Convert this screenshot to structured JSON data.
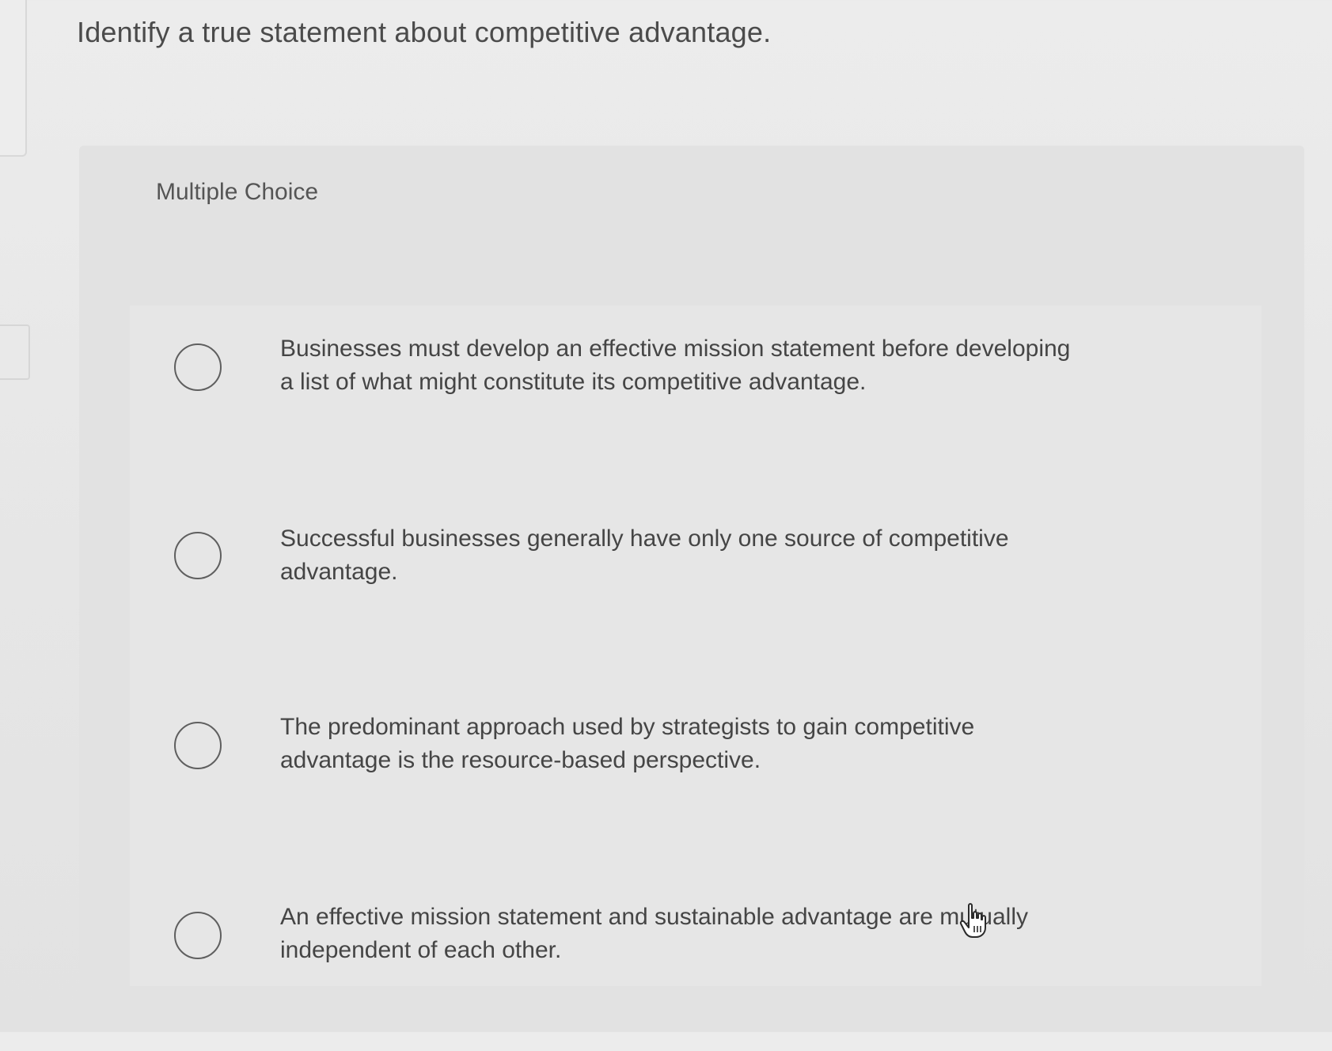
{
  "question": {
    "text": "Identify a true statement about competitive advantage."
  },
  "panel": {
    "label": "Multiple Choice"
  },
  "options": [
    {
      "text": "Businesses must develop an effective mission statement before developing a list of what might constitute its competitive advantage."
    },
    {
      "text": "Successful businesses generally have only one source of competitive advantage."
    },
    {
      "text": "The predominant approach used by strategists to gain competitive advantage is the resource-based perspective."
    },
    {
      "text": "An effective mission statement and sustainable advantage are mutually independent of each other."
    }
  ],
  "icons": {
    "radio": "radio-button-icon",
    "cursor": "hand-pointer-icon"
  }
}
